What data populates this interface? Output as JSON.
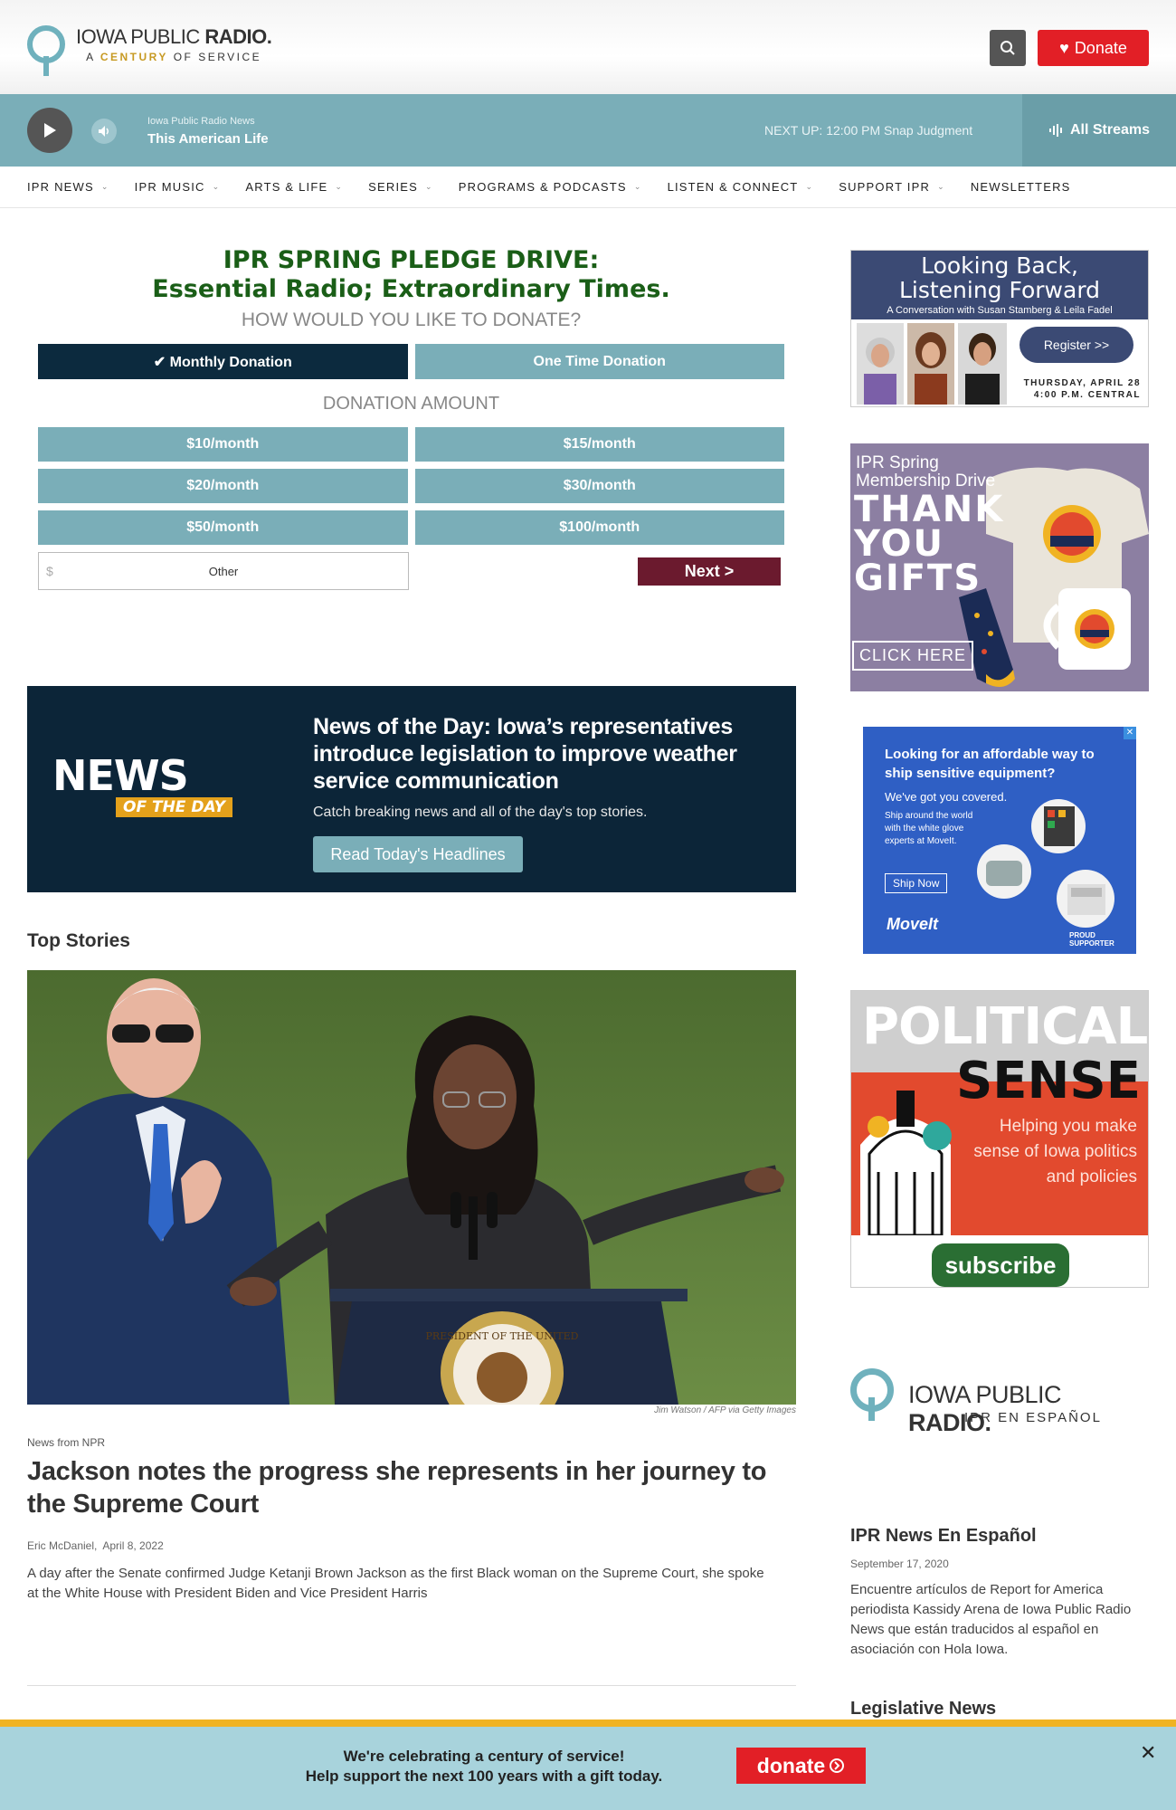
{
  "header": {
    "logo_line1_a": "IOWA PUBLIC ",
    "logo_line1_b": "RADIO.",
    "logo_line2_a": "A ",
    "logo_line2_b": "CENTURY",
    "logo_line2_c": " OF SERVICE",
    "donate_label": "Donate"
  },
  "player": {
    "station": "Iowa Public Radio News",
    "show": "This American Life",
    "next_up": "NEXT UP: 12:00 PM Snap Judgment",
    "all_streams": "All Streams"
  },
  "nav": {
    "items": [
      "IPR NEWS",
      "IPR MUSIC",
      "ARTS & LIFE",
      "SERIES",
      "PROGRAMS & PODCASTS",
      "LISTEN & CONNECT",
      "SUPPORT IPR",
      "NEWSLETTERS"
    ]
  },
  "pledge": {
    "title_line1": "IPR SPRING PLEDGE DRIVE:",
    "title_line2": "Essential Radio; Extraordinary Times.",
    "question": "HOW WOULD YOU LIKE TO DONATE?",
    "monthly": "✔ Monthly Donation",
    "one_time": "One Time Donation",
    "amount_title": "DONATION AMOUNT",
    "amounts": [
      "$10/month",
      "$15/month",
      "$20/month",
      "$30/month",
      "$50/month",
      "$100/month"
    ],
    "other_currency": "$",
    "other_placeholder": "Other",
    "next": "Next >"
  },
  "news_of_day": {
    "logo_news": "NEWS",
    "logo_otd": "OF THE DAY",
    "headline": "News of the Day: Iowa’s representatives introduce legislation to improve weather service communication",
    "sub": "Catch breaking news and all of the day's top stories.",
    "button": "Read Today's Headlines"
  },
  "top_stories": {
    "title": "Top Stories",
    "photo_credit": "Jim Watson / AFP via Getty Images",
    "source": "News from NPR",
    "headline": "Jackson notes the progress she represents in her journey to the Supreme Court",
    "author": "Eric McDaniel,",
    "date": "April 8, 2022",
    "teaser": "A day after the Senate confirmed Judge Ketanji Brown Jackson as the first Black woman on the Supreme Court, she spoke at the White House with President Biden and Vice President Harris",
    "podium_seal": "PRESIDENT OF THE UNITED"
  },
  "sidebar": {
    "ad1": {
      "heading_line1": "Looking Back,",
      "heading_line2": "Listening Forward",
      "sub": "A Conversation with Susan Stamberg & Leila Fadel",
      "register": "Register >>",
      "date_line1": "THURSDAY, APRIL 28",
      "date_line2": "4:00 P.M. CENTRAL"
    },
    "ad2": {
      "line1": "IPR Spring",
      "line2": "Membership Drive",
      "big1": "THANK",
      "big2": "YOU",
      "big3": "GIFTS",
      "click": "CLICK HERE"
    },
    "ad3": {
      "close": "✕",
      "headline": "Looking for an affordable way to ship sensitive equipment?",
      "sub1": "We've got you covered.",
      "sub2": "Ship around the world with the white glove experts at MoveIt.",
      "ship": "Ship Now",
      "brand": "MoveIt",
      "proud1": "PROUD",
      "proud2": "SUPPORTER"
    },
    "ad4": {
      "political": "POLITICAL",
      "sense": "SENSE",
      "help": "Helping you make sense of Iowa politics and policies",
      "subscribe": "subscribe"
    },
    "es_logo_a": "IOWA PUBLIC ",
    "es_logo_b": "RADIO.",
    "es_logo_sub": "IPR EN ESPAÑOL",
    "es_title": "IPR News En Español",
    "es_date": "September 17, 2020",
    "es_teaser": "Encuentre artículos de Report for America periodista Kassidy Arena de Iowa Public Radio News que están traducidos al español en asociación con Hola Iowa.",
    "legislative_title": "Legislative News"
  },
  "bottom_banner": {
    "line1": "We're celebrating a century of service!",
    "line2": "Help support the next 100 years with a gift today.",
    "donate": "donate",
    "close": "✕"
  },
  "colors": {
    "teal": "#7aaeb8",
    "navy": "#0c2a3e",
    "red": "#e21f26",
    "green_title": "#1a5e17",
    "next_btn": "#6b1a2e",
    "gold": "#f0b323"
  }
}
